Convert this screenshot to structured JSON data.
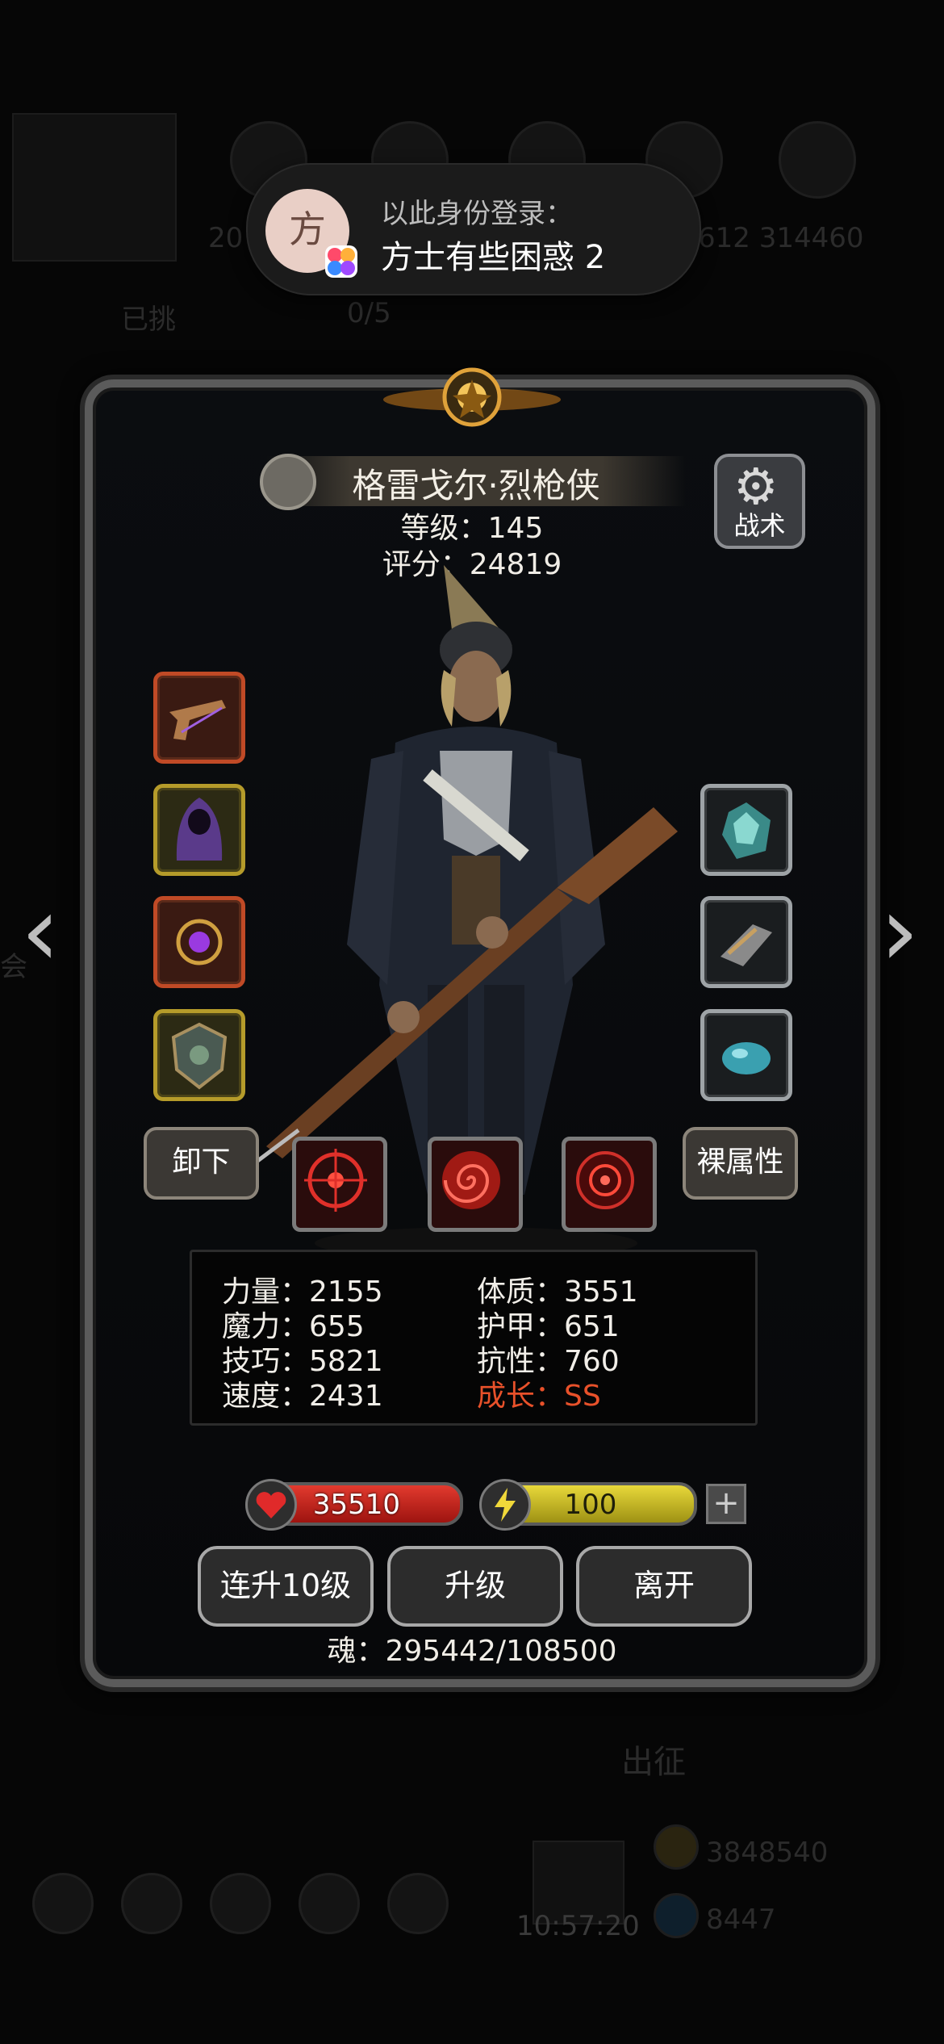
{
  "toast": {
    "avatar_char": "方",
    "line1": "以此身份登录：",
    "line2": "方士有些困惑 2"
  },
  "background": {
    "number_left": "20",
    "numbers_right": "612  314460",
    "already_text": "已挑",
    "progress": "0/5",
    "cloud_char": "会",
    "go_label": "出征",
    "gold": "3848540",
    "gems": "8447",
    "time": "10:57:20"
  },
  "hero": {
    "name": "格雷戈尔·烈枪侠",
    "level_label": "等级：145",
    "score_label": "评分：24819"
  },
  "buttons": {
    "tactics": "战术",
    "unequip": "卸下",
    "bare_attributes": "裸属性",
    "level_up_10": "连升10级",
    "level_up": "升级",
    "leave": "离开"
  },
  "stats": {
    "strength": "力量：2155",
    "magic": "魔力：655",
    "skill": "技巧：5821",
    "speed": "速度：2431",
    "constitution": "体质：3551",
    "armor": "护甲：651",
    "resistance": "抗性：760",
    "growth": "成长：SS"
  },
  "bars": {
    "hp": "35510",
    "energy": "100"
  },
  "soul": "魂：295442/108500",
  "colors": {
    "growth": "#e8512a",
    "hp": "#d2281e",
    "energy": "#e0cf34"
  },
  "icons": {
    "left_slots": [
      "flintlock-pistol-icon",
      "hooded-cloak-icon",
      "purple-amulet-icon",
      "bronze-shield-icon"
    ],
    "right_slots": [
      "teal-crystal-icon",
      "silver-bracer-icon",
      "blue-stone-icon"
    ],
    "skills": [
      "crosshair-skill-icon",
      "spiral-skill-icon",
      "target-skill-icon"
    ]
  }
}
